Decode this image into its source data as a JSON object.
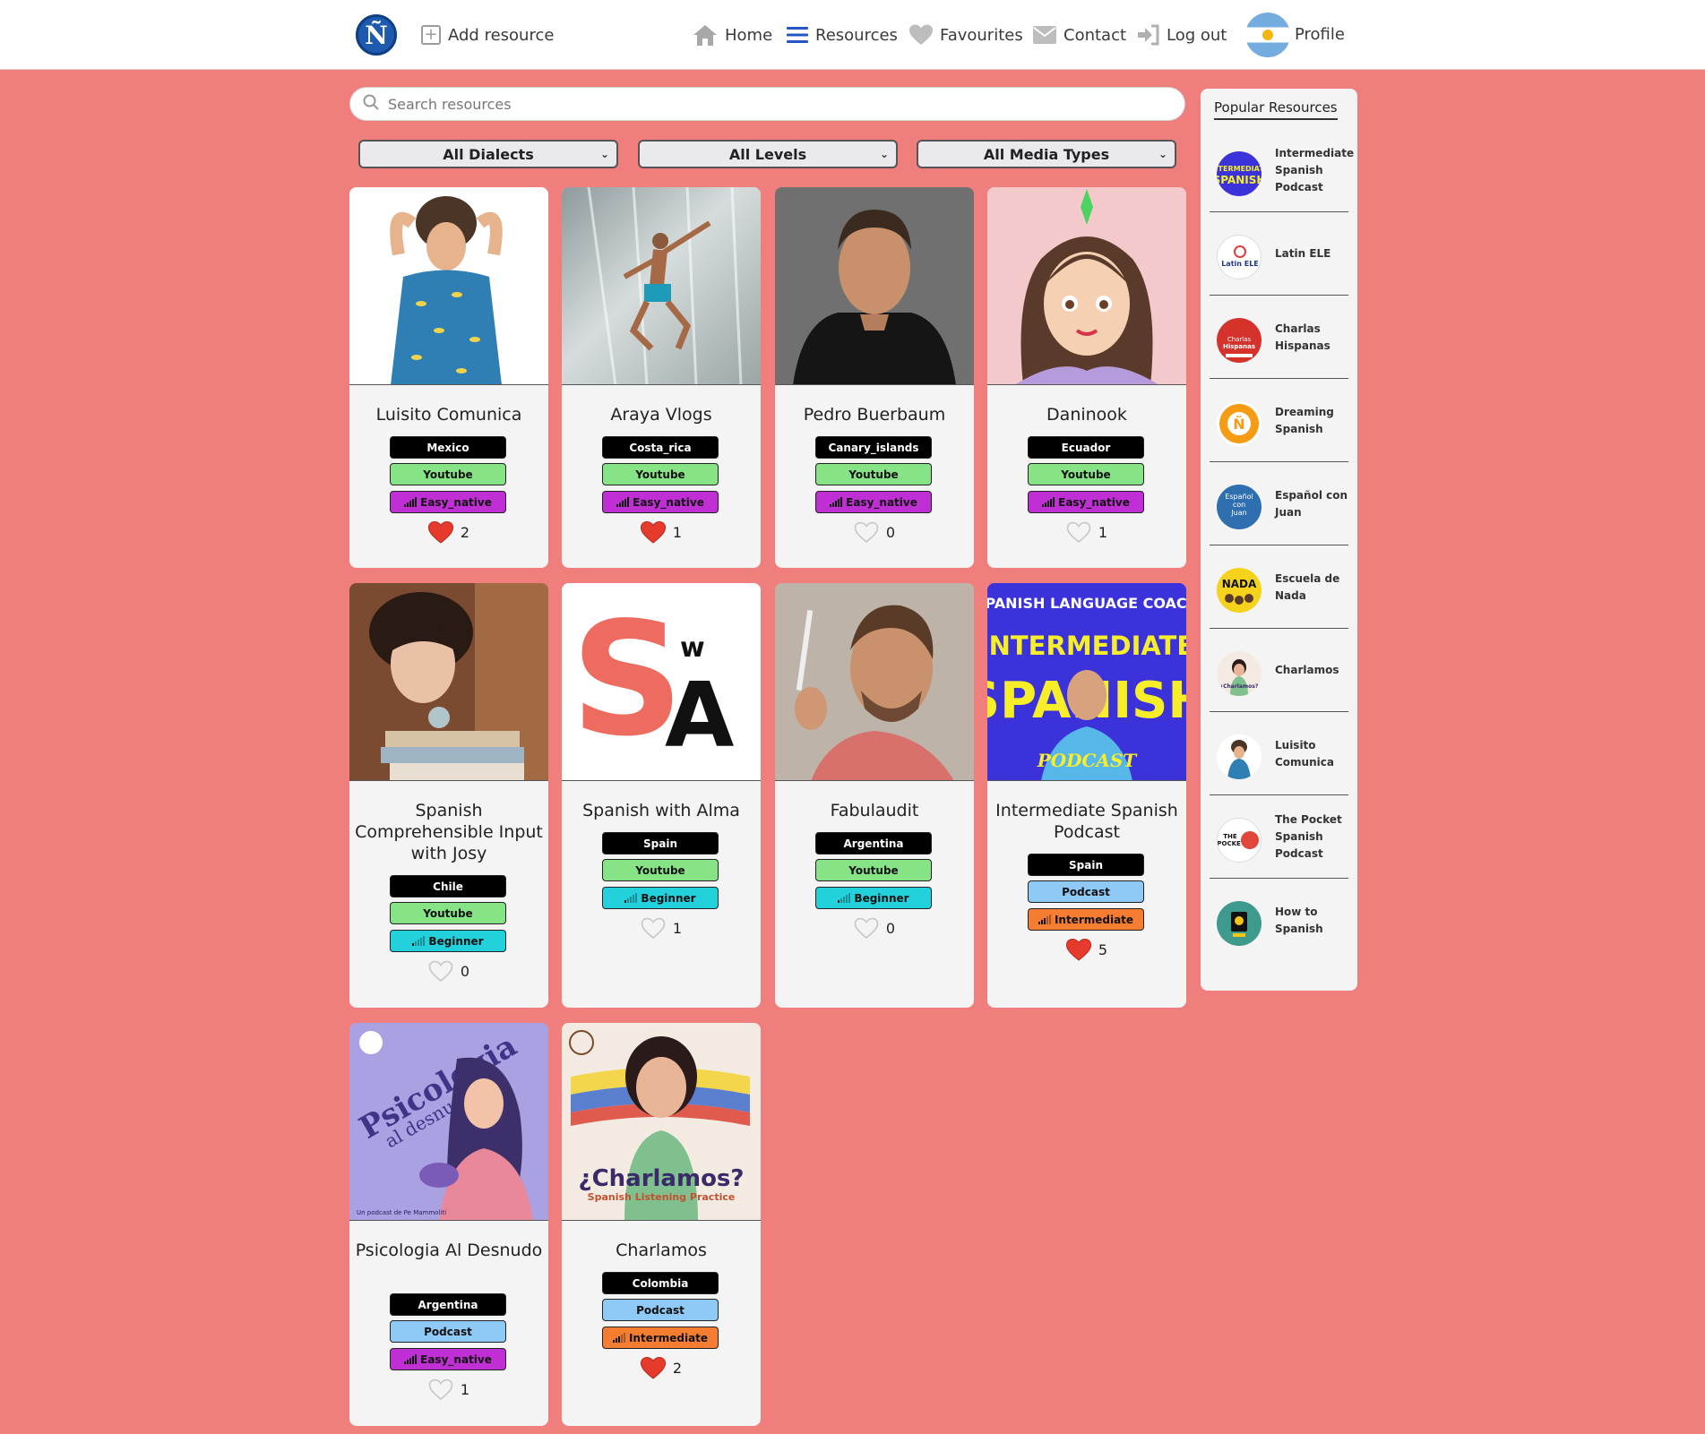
{
  "nav": {
    "logo": "Ñ",
    "add_resource": "Add resource",
    "home": "Home",
    "resources": "Resources",
    "favourites": "Favourites",
    "contact": "Contact",
    "logout": "Log out",
    "profile": "Profile"
  },
  "search": {
    "placeholder": "Search resources"
  },
  "filters": {
    "dialects": "All Dialects",
    "levels": "All Levels",
    "media": "All Media Types"
  },
  "cards": [
    {
      "title": "Luisito Comunica",
      "dialect": "Mexico",
      "media": "Youtube",
      "level": "Easy_native",
      "likes": "2",
      "liked": true
    },
    {
      "title": "Araya Vlogs",
      "dialect": "Costa_rica",
      "media": "Youtube",
      "level": "Easy_native",
      "likes": "1",
      "liked": true
    },
    {
      "title": "Pedro Buerbaum",
      "dialect": "Canary_islands",
      "media": "Youtube",
      "level": "Easy_native",
      "likes": "0",
      "liked": false
    },
    {
      "title": "Daninook",
      "dialect": "Ecuador",
      "media": "Youtube",
      "level": "Easy_native",
      "likes": "1",
      "liked": false
    },
    {
      "title": "Spanish Comprehensible Input with Josy",
      "dialect": "Chile",
      "media": "Youtube",
      "level": "Beginner",
      "likes": "0",
      "liked": false
    },
    {
      "title": "Spanish with Alma",
      "dialect": "Spain",
      "media": "Youtube",
      "level": "Beginner",
      "likes": "1",
      "liked": false
    },
    {
      "title": "Fabulaudit",
      "dialect": "Argentina",
      "media": "Youtube",
      "level": "Beginner",
      "likes": "0",
      "liked": false
    },
    {
      "title": "Intermediate Spanish Podcast",
      "dialect": "Spain",
      "media": "Podcast",
      "level": "Intermediate",
      "likes": "5",
      "liked": true
    },
    {
      "title": "Psicologia Al Desnudo",
      "dialect": "Argentina",
      "media": "Podcast",
      "level": "Easy_native",
      "likes": "1",
      "liked": false
    },
    {
      "title": "Charlamos",
      "dialect": "Colombia",
      "media": "Podcast",
      "level": "Intermediate",
      "likes": "2",
      "liked": true
    }
  ],
  "thumb_text": {
    "alma_s": "S",
    "alma_w": "w",
    "alma_a": "A",
    "isp_top": "SPANISH LANGUAGE COACH",
    "isp_mid1": "INTERMEDIATE",
    "isp_mid2": "SPANISH",
    "isp_bottom": "PODCAST",
    "psico_title": "Psicologia",
    "psico_sub": "al desnudo",
    "psico_credit": "Un podcast de Pe Mammoliti",
    "charla_title": "¿Charlamos?",
    "charla_sub": "Spanish Listening Practice"
  },
  "popular": {
    "title": "Popular Resources",
    "items": [
      {
        "label": "Intermediate Spanish Podcast",
        "thumb_text": "INTERMEDIATE SPANISH"
      },
      {
        "label": "Latin ELE",
        "thumb_text": "Latin ELE"
      },
      {
        "label": "Charlas Hispanas",
        "thumb_text": "Charlas Hispanas"
      },
      {
        "label": "Dreaming Spanish",
        "thumb_text": "Ñ"
      },
      {
        "label": "Español con Juan",
        "thumb_text": "Español con Juan"
      },
      {
        "label": "Escuela de Nada",
        "thumb_text": "NADA"
      },
      {
        "label": "Charlamos",
        "thumb_text": "¿Charlamos?"
      },
      {
        "label": "Luisito Comunica",
        "thumb_text": ""
      },
      {
        "label": "The Pocket Spanish Podcast",
        "thumb_text": "THE POCKET"
      },
      {
        "label": "How to Spanish",
        "thumb_text": ""
      }
    ]
  },
  "colors": {
    "background": "#f07e7c",
    "heart_filled": "#e63a2c",
    "dialect": "#000000",
    "youtube": "#86e386",
    "podcast": "#8fcaf6",
    "easy_native": "#c02fd3",
    "beginner": "#23d1dc",
    "intermediate": "#f57d32"
  },
  "icons": {
    "logo": "n-tilde-logo",
    "add": "plus-square-icon",
    "home": "home-icon",
    "resources": "hamburger-icon",
    "favourites": "heart-icon",
    "contact": "envelope-icon",
    "logout": "logout-icon",
    "profile": "argentina-flag-avatar",
    "search": "search-icon",
    "level": "signal-bars-icon",
    "like": "heart-icon"
  }
}
